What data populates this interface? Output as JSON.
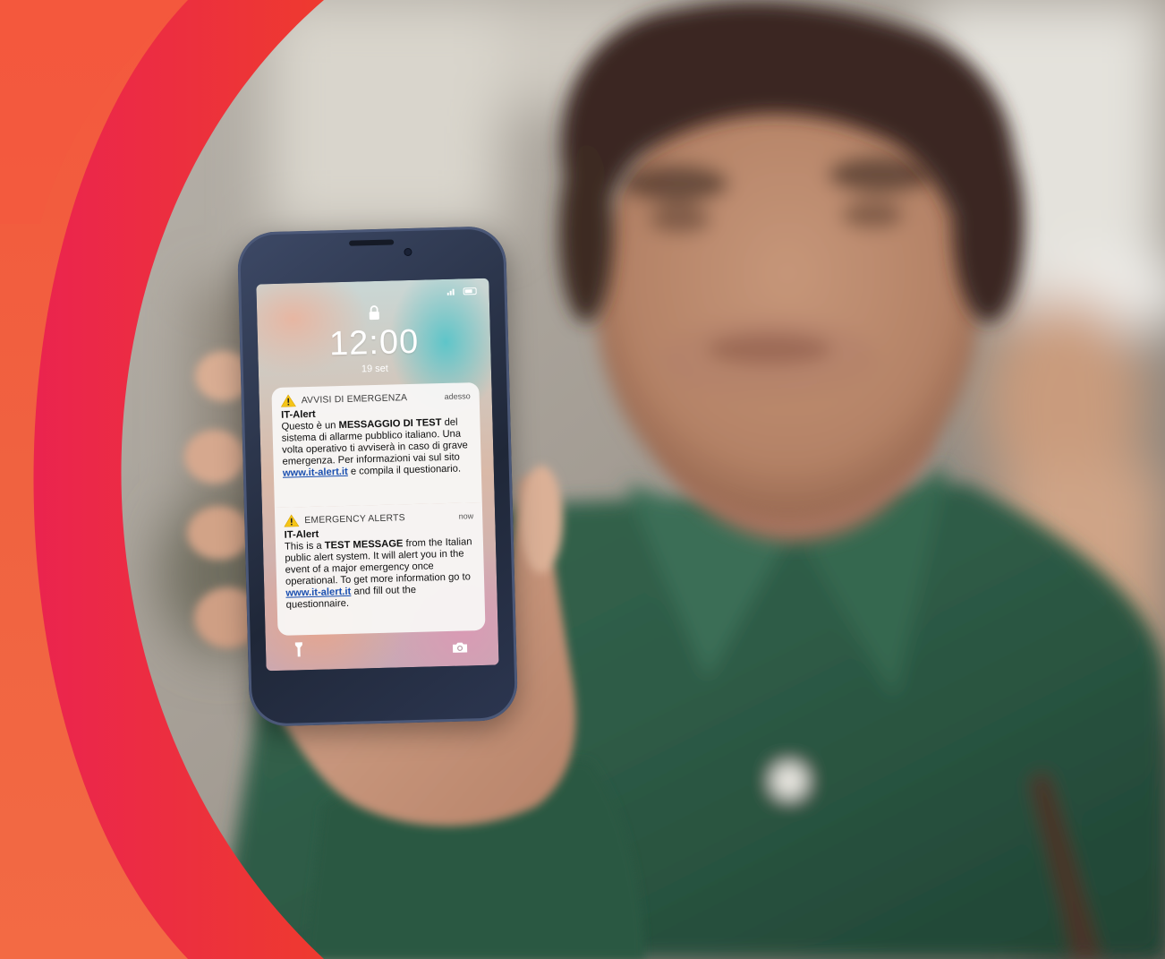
{
  "colors": {
    "arc_outer": "#f0543a",
    "arc_inner": "#e41e4c",
    "shirt": "#2c5a44",
    "link": "#1a4fb0"
  },
  "phone": {
    "clock": "12:00",
    "date": "19 set",
    "notifications": {
      "it": {
        "app_label": "AVVISI DI EMERGENZA",
        "time": "adesso",
        "title": "IT-Alert",
        "body_pre": "Questo è un ",
        "body_bold": "MESSAGGIO DI TEST",
        "body_post": " del sistema di allarme pubblico italiano. Una volta operativo ti avviserà in caso di grave emergenza. Per informazioni vai sul sito ",
        "link": "www.it-alert.it",
        "body_end": " e compila il questionario."
      },
      "en": {
        "app_label": "EMERGENCY ALERTS",
        "time": "now",
        "title": "IT-Alert",
        "body_pre": "This is a ",
        "body_bold": "TEST MESSAGE",
        "body_post": " from the Italian public alert system. It will alert you in the event of a major emergency once operational. To get more information go to ",
        "link": "www.it-alert.it",
        "body_end": " and fill out the questionnaire."
      }
    },
    "icons": [
      "lock-icon",
      "warning-icon",
      "flashlight-icon",
      "camera-icon",
      "signal-icon",
      "battery-icon"
    ]
  }
}
